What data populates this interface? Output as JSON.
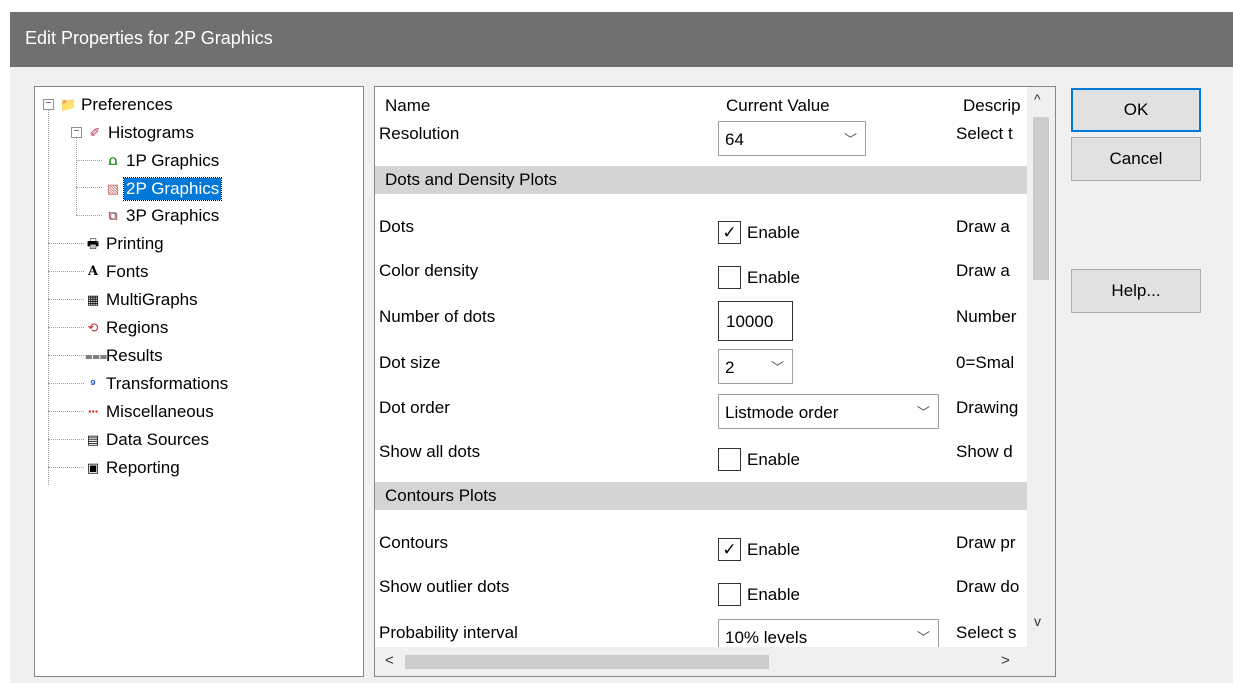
{
  "window": {
    "title": "Edit Properties for 2P Graphics"
  },
  "tree": {
    "items": [
      {
        "label": "Preferences",
        "icon": "folder-icon",
        "glyph": "📁"
      },
      {
        "label": "Histograms",
        "icon": "histogram-pen-icon",
        "glyph": "✐"
      },
      {
        "label": "1P Graphics",
        "icon": "1p-graphic-icon",
        "glyph": "⩍"
      },
      {
        "label": "2P Graphics",
        "icon": "2p-graphic-icon",
        "glyph": "▧"
      },
      {
        "label": "3P Graphics",
        "icon": "3p-graphic-icon",
        "glyph": "⧉"
      },
      {
        "label": "Printing",
        "icon": "printer-icon",
        "glyph": "🖶"
      },
      {
        "label": "Fonts",
        "icon": "font-icon",
        "glyph": "A"
      },
      {
        "label": "MultiGraphs",
        "icon": "multigraph-icon",
        "glyph": "▦"
      },
      {
        "label": "Regions",
        "icon": "regions-icon",
        "glyph": "⟲"
      },
      {
        "label": "Results",
        "icon": "results-icon",
        "glyph": "⩶"
      },
      {
        "label": "Transformations",
        "icon": "transformations-icon",
        "glyph": "⁹"
      },
      {
        "label": "Miscellaneous",
        "icon": "dotted-line-icon",
        "glyph": "···"
      },
      {
        "label": "Data Sources",
        "icon": "data-source-icon",
        "glyph": "▤"
      },
      {
        "label": "Reporting",
        "icon": "report-icon",
        "glyph": "▣"
      }
    ]
  },
  "grid": {
    "headers": {
      "name": "Name",
      "value": "Current Value",
      "desc": "Descrip"
    },
    "resolution": {
      "name": "Resolution",
      "value": "64",
      "desc": "Select t"
    },
    "section1": "Dots and Density Plots",
    "dots": {
      "name": "Dots",
      "check": "Enable",
      "desc": "Draw a"
    },
    "color_density": {
      "name": "Color density",
      "check": "Enable",
      "desc": "Draw a"
    },
    "number_of_dots": {
      "name": "Number of dots",
      "value": "10000",
      "desc": "Number"
    },
    "dot_size": {
      "name": "Dot size",
      "value": "2",
      "desc": "0=Smal"
    },
    "dot_order": {
      "name": "Dot order",
      "value": "Listmode order",
      "desc": "Drawing"
    },
    "show_all_dots": {
      "name": "Show all dots",
      "check": "Enable",
      "desc": "Show d"
    },
    "section2": "Contours Plots",
    "contours": {
      "name": "Contours",
      "check": "Enable",
      "desc": "Draw pr"
    },
    "show_outlier": {
      "name": "Show outlier dots",
      "check": "Enable",
      "desc": "Draw do"
    },
    "probability": {
      "name": "Probability interval",
      "value": "10% levels",
      "desc": "Select s"
    },
    "checkmark": "✓",
    "chevron": "﹀"
  },
  "buttons": {
    "ok": "OK",
    "cancel": "Cancel",
    "help": "Help..."
  },
  "scroll": {
    "up": "^",
    "down": "v",
    "left": "<",
    "right": ">"
  }
}
